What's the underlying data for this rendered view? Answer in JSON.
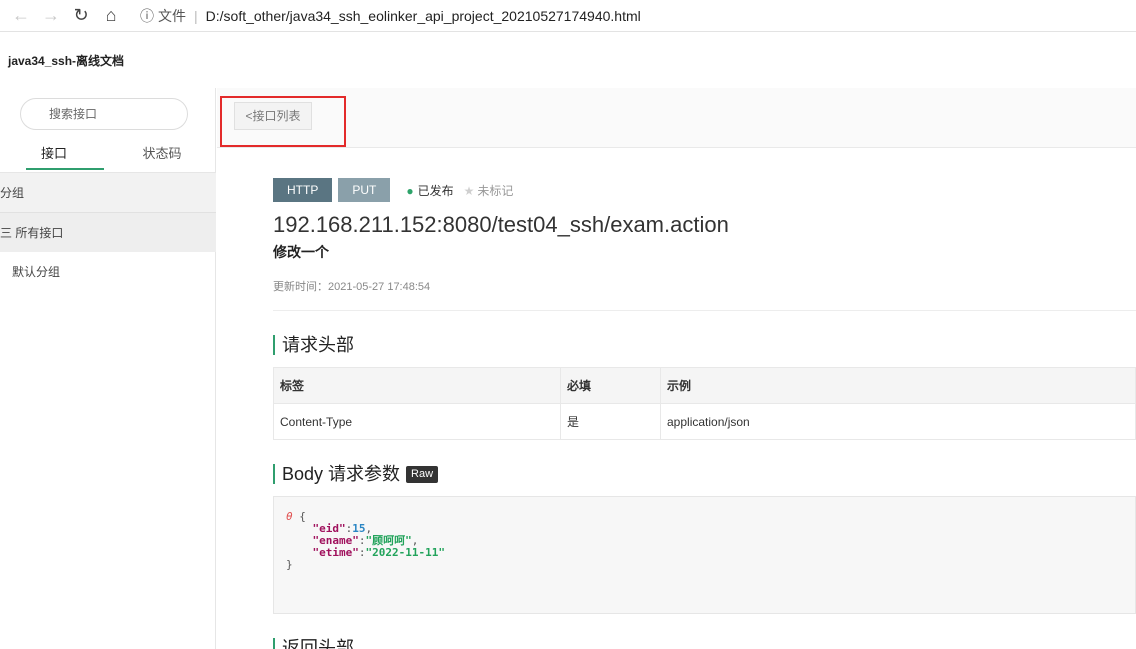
{
  "browser": {
    "info_icon": "info-icon",
    "scheme": "文件",
    "separator": "|",
    "url": "D:/soft_other/java34_ssh_eolinker_api_project_20210527174940.html"
  },
  "app": {
    "title": "java34_ssh-离线文档"
  },
  "sidebar": {
    "search_placeholder": "搜索接口",
    "tabs": [
      {
        "label": "接口"
      },
      {
        "label": "状态码"
      }
    ],
    "group_header": "分组",
    "all_apis": "三 所有接口",
    "default_group": "默认分组"
  },
  "toolbar": {
    "back_label": "<接口列表"
  },
  "api": {
    "protocol": "HTTP",
    "method": "PUT",
    "status": "已发布",
    "mark": "未标记",
    "url": "192.168.211.152:8080/test04_ssh/exam.action",
    "name": "修改一个",
    "updated": "更新时间：2021-05-27 17:48:54"
  },
  "request_headers": {
    "title": "请求头部",
    "columns": [
      "标签",
      "必填",
      "示例"
    ],
    "rows": [
      {
        "label": "Content-Type",
        "required": "是",
        "example": "application/json"
      }
    ]
  },
  "body": {
    "title": "Body 请求参数",
    "badge": "Raw",
    "json_lines": {
      "open": "{",
      "k1": "\"eid\"",
      "v1": "15",
      "k2": "\"ename\"",
      "v2": "\"顾呵呵\"",
      "k3": "\"etime\"",
      "v3": "\"2022-11-11\"",
      "close": "}"
    }
  },
  "response_headers": {
    "title": "返回头部"
  }
}
